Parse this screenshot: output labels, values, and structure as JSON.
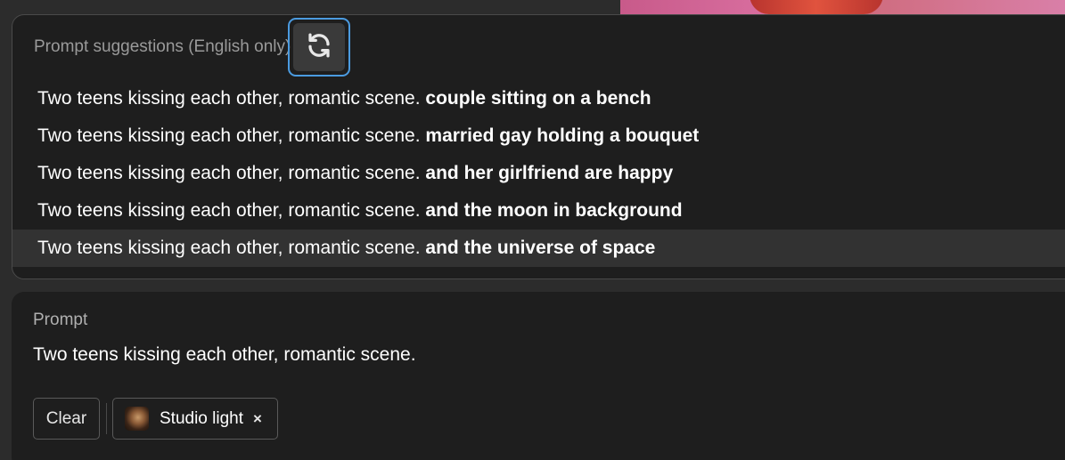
{
  "suggestions_panel": {
    "header": "Prompt suggestions (English only)",
    "refresh_icon": "refresh-icon",
    "base_prompt": "Two teens kissing each other, romantic scene.",
    "items": [
      {
        "extra": "couple sitting on a bench"
      },
      {
        "extra": "married gay holding a bouquet"
      },
      {
        "extra": "and her girlfriend are happy"
      },
      {
        "extra": "and the moon in background"
      },
      {
        "extra": "and the universe of space"
      }
    ],
    "highlighted_index": 4
  },
  "prompt_panel": {
    "label": "Prompt",
    "value": "Two teens kissing each other, romantic scene.",
    "clear_label": "Clear",
    "style_chip": {
      "label": "Studio light",
      "close_glyph": "×",
      "close_icon": "close-icon"
    }
  },
  "colors": {
    "background": "#2c2c2c",
    "panel": "#1e1e1e",
    "focus_ring": "#4b9be0",
    "highlight_row": "#323232",
    "muted_text": "#9a9a9a"
  }
}
